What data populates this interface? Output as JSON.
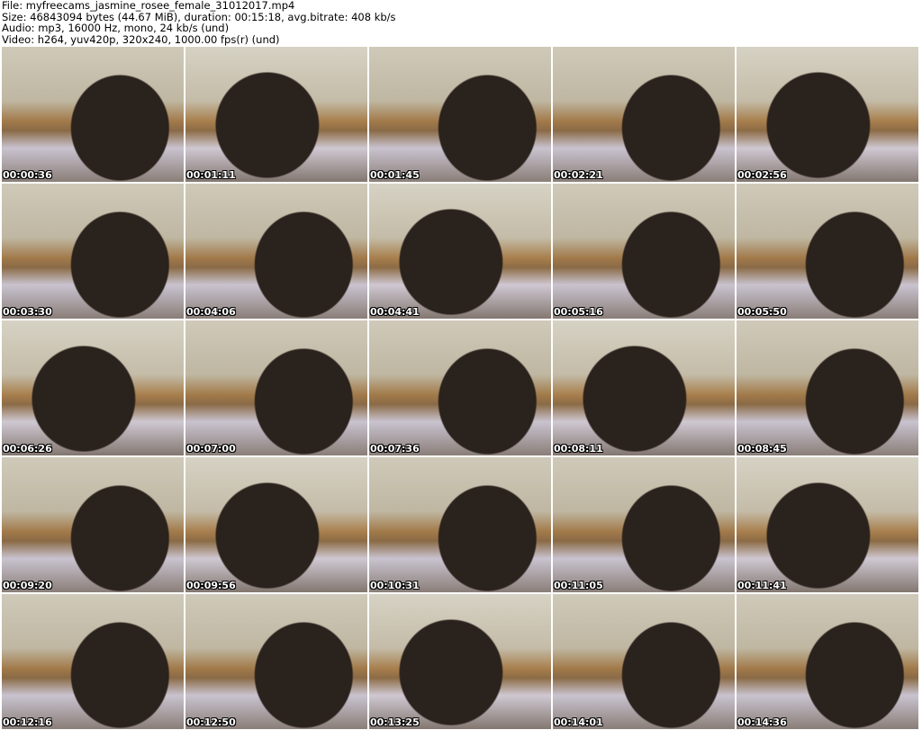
{
  "header": {
    "file": "File: myfreecams_jasmine_rosee_female_31012017.mp4",
    "size": "Size: 46843094 bytes (44.67 MiB), duration: 00:15:18, avg.bitrate: 408 kb/s",
    "audio": "Audio: mp3, 16000 Hz, mono, 24 kb/s (und)",
    "video": "Video: h264, yuv420p, 320x240, 1000.00 fps(r) (und)"
  },
  "thumbnails": [
    "00:00:36",
    "00:01:11",
    "00:01:45",
    "00:02:21",
    "00:02:56",
    "00:03:30",
    "00:04:06",
    "00:04:41",
    "00:05:16",
    "00:05:50",
    "00:06:26",
    "00:07:00",
    "00:07:36",
    "00:08:11",
    "00:08:45",
    "00:09:20",
    "00:09:56",
    "00:10:31",
    "00:11:05",
    "00:11:41",
    "00:12:16",
    "00:12:50",
    "00:13:25",
    "00:14:01",
    "00:14:36"
  ]
}
